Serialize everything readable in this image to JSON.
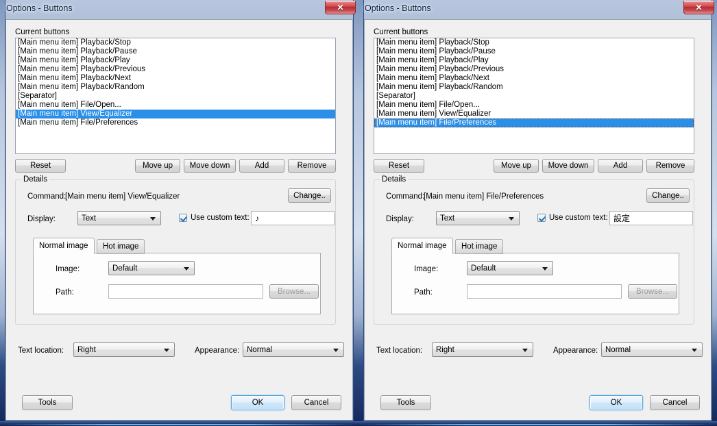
{
  "windows": [
    {
      "title": "Options - Buttons",
      "close_icon": "close-icon",
      "list_label": "Current buttons",
      "list_items": [
        "[Main menu item] Playback/Stop",
        "[Main menu item] Playback/Pause",
        "[Main menu item] Playback/Play",
        "[Main menu item] Playback/Previous",
        "[Main menu item] Playback/Next",
        "[Main menu item] Playback/Random",
        "[Separator]",
        "[Main menu item] File/Open...",
        "[Main menu item] View/Equalizer",
        "[Main menu item] File/Preferences"
      ],
      "selected_index": 8,
      "list_buttons": {
        "reset": "Reset",
        "move_up": "Move up",
        "move_down": "Move down",
        "add": "Add",
        "remove": "Remove"
      },
      "details": {
        "group_title": "Details",
        "command_label": "Command:",
        "command_value": "[Main menu item] View/Equalizer",
        "change_button": "Change..",
        "display_label": "Display:",
        "display_value": "Text",
        "custom_text_checkbox": "Use custom text:",
        "custom_text_value": "♪",
        "tabs": [
          {
            "label": "Normal image",
            "active": true
          },
          {
            "label": "Hot image",
            "active": false
          }
        ],
        "image_label": "Image:",
        "image_value": "Default",
        "path_label": "Path:",
        "path_value": "",
        "browse_button": "Browse..."
      },
      "footer": {
        "text_location_label": "Text location:",
        "text_location_value": "Right",
        "appearance_label": "Appearance:",
        "appearance_value": "Normal",
        "tools_button": "Tools",
        "ok_button": "OK",
        "cancel_button": "Cancel"
      }
    },
    {
      "title": "Options - Buttons",
      "close_icon": "close-icon",
      "list_label": "Current buttons",
      "list_items": [
        "[Main menu item] Playback/Stop",
        "[Main menu item] Playback/Pause",
        "[Main menu item] Playback/Play",
        "[Main menu item] Playback/Previous",
        "[Main menu item] Playback/Next",
        "[Main menu item] Playback/Random",
        "[Separator]",
        "[Main menu item] File/Open...",
        "[Main menu item] View/Equalizer",
        "[Main menu item] File/Preferences"
      ],
      "selected_index": 9,
      "list_buttons": {
        "reset": "Reset",
        "move_up": "Move up",
        "move_down": "Move down",
        "add": "Add",
        "remove": "Remove"
      },
      "details": {
        "group_title": "Details",
        "command_label": "Command:",
        "command_value": "[Main menu item] File/Preferences",
        "change_button": "Change..",
        "display_label": "Display:",
        "display_value": "Text",
        "custom_text_checkbox": "Use custom text:",
        "custom_text_value": "設定",
        "tabs": [
          {
            "label": "Normal image",
            "active": true
          },
          {
            "label": "Hot image",
            "active": false
          }
        ],
        "image_label": "Image:",
        "image_value": "Default",
        "path_label": "Path:",
        "path_value": "",
        "browse_button": "Browse..."
      },
      "footer": {
        "text_location_label": "Text location:",
        "text_location_value": "Right",
        "appearance_label": "Appearance:",
        "appearance_value": "Normal",
        "tools_button": "Tools",
        "ok_button": "OK",
        "cancel_button": "Cancel"
      }
    }
  ],
  "colors": {
    "selection_blue": "#2a8fe8",
    "close_red": "#c4474c",
    "default_button_border": "#4ea3de",
    "client_bg": "#f0f0f0"
  }
}
